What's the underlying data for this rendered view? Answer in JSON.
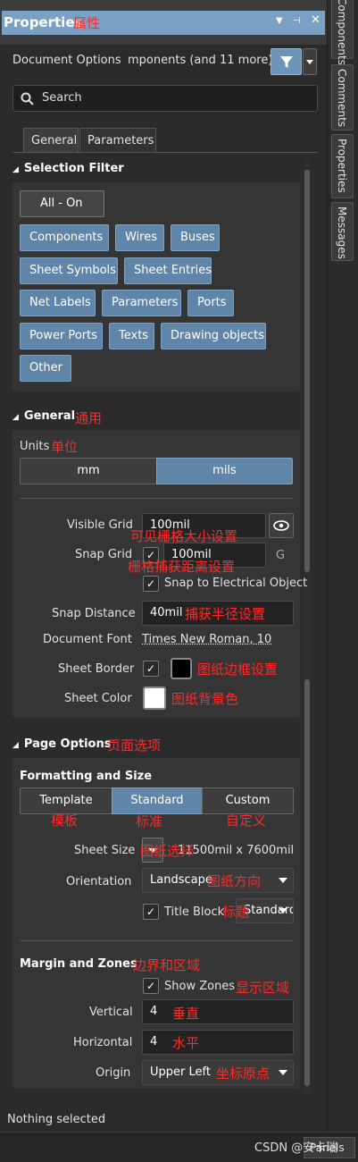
{
  "title": "Properties",
  "annotations": {
    "title": "属性",
    "general": "通用",
    "units": "单位",
    "visible_grid": "可见栅格大小设置",
    "snap_grid": "栅格捕获距离设置",
    "snap_distance": "捕获半径设置",
    "sheet_border": "图纸边框设置",
    "sheet_color": "图纸背景色",
    "page_options": "页面选项",
    "template": "模板",
    "standard": "标准",
    "custom": "自定义",
    "sheet_size": "图纸选择",
    "orientation": "图纸方向",
    "title_block": "标题",
    "margin_zones": "边界和区域",
    "show_zones": "显示区域",
    "vertical": "垂直",
    "horizontal": "水平",
    "origin": "坐标原点"
  },
  "dock_tabs": [
    "Components",
    "Comments",
    "Properties",
    "Messages"
  ],
  "doc_options": {
    "label": "Document Options",
    "scope": "mponents (and 11 more)"
  },
  "search": {
    "placeholder": "Search"
  },
  "tabs": [
    "General",
    "Parameters"
  ],
  "selection_filter": {
    "heading": "Selection Filter",
    "all_on": "All - On",
    "buttons": [
      "Components",
      "Wires",
      "Buses",
      "Sheet Symbols",
      "Sheet Entries",
      "Net Labels",
      "Parameters",
      "Ports",
      "Power Ports",
      "Texts",
      "Drawing objects",
      "Other"
    ]
  },
  "general": {
    "heading": "General",
    "units_label": "Units",
    "units": [
      "mm",
      "mils"
    ],
    "units_selected": "mils",
    "visible_grid_label": "Visible Grid",
    "visible_grid_value": "100mil",
    "snap_grid_label": "Snap Grid",
    "snap_grid_value": "100mil",
    "snap_grid_shortcut": "G",
    "snap_electrical_label": "Snap to Electrical Object",
    "snap_distance_label": "Snap Distance",
    "snap_distance_value": "40mil",
    "document_font_label": "Document Font",
    "document_font_value": "Times New Roman, 10",
    "sheet_border_label": "Sheet Border",
    "sheet_color_label": "Sheet Color",
    "sheet_border_color": "#000000",
    "sheet_color_value": "#ffffff"
  },
  "page_options": {
    "heading": "Page Options",
    "formatting_heading": "Formatting and Size",
    "formats": [
      "Template",
      "Standard",
      "Custom"
    ],
    "format_selected": "Standard",
    "sheet_size_label": "Sheet Size",
    "sheet_size_value": "11500mil  x  7600mil",
    "orientation_label": "Orientation",
    "orientation_value": "Landscape",
    "title_block_label": "Title Block",
    "title_block_value": "Standard",
    "margin_heading": "Margin and Zones",
    "show_zones_label": "Show Zones",
    "vertical_label": "Vertical",
    "vertical_value": "4",
    "horizontal_label": "Horizontal",
    "horizontal_value": "4",
    "origin_label": "Origin",
    "origin_value": "Upper Left"
  },
  "status": "Nothing selected",
  "panels_button": "Panels",
  "watermark": "CSDN @安卡瑞"
}
